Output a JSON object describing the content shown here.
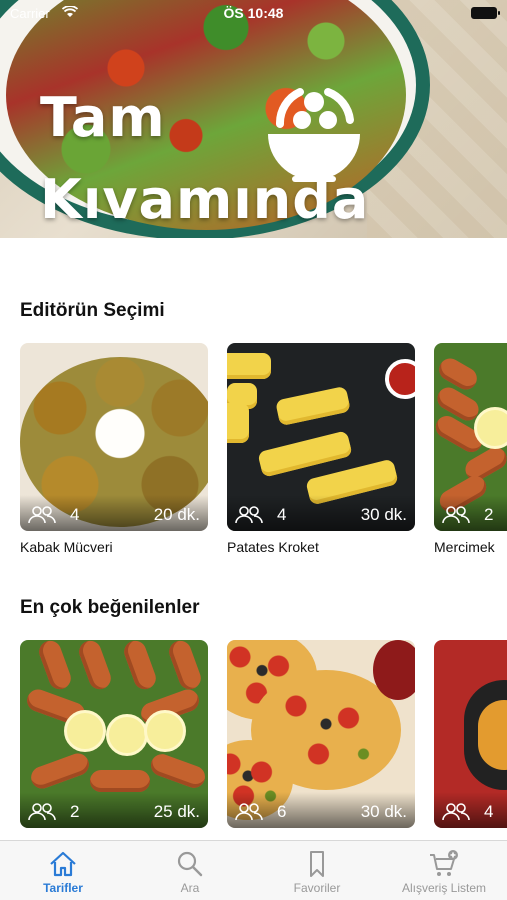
{
  "status_bar": {
    "carrier": "Carrier",
    "time": "ÖS 10:48"
  },
  "header": {
    "logo_line1": "Tam",
    "logo_line2": "Kıvamında"
  },
  "sections": {
    "editors_choice": {
      "title": "Editörün Seçimi",
      "cards": [
        {
          "name": "Kabak Mücveri",
          "servings": "4",
          "time": "20 dk."
        },
        {
          "name": "Patates Kroket",
          "servings": "4",
          "time": "30 dk."
        },
        {
          "name": "Mercimek",
          "servings": "2",
          "time": ""
        }
      ]
    },
    "most_liked": {
      "title": "En çok beğenilenler",
      "cards": [
        {
          "name": "",
          "servings": "2",
          "time": "25 dk."
        },
        {
          "name": "",
          "servings": "6",
          "time": "30 dk."
        },
        {
          "name": "",
          "servings": "4",
          "time": ""
        }
      ]
    }
  },
  "tabbar": {
    "items": [
      {
        "label": "Tarifler",
        "icon": "home-icon",
        "active": true
      },
      {
        "label": "Ara",
        "icon": "search-icon",
        "active": false
      },
      {
        "label": "Favoriler",
        "icon": "bookmark-icon",
        "active": false
      },
      {
        "label": "Alışveriş Listem",
        "icon": "cart-add-icon",
        "active": false
      }
    ]
  },
  "colors": {
    "accent": "#2a7bd6",
    "inactive": "#999999",
    "plate_rim": "#1e6b5a"
  }
}
